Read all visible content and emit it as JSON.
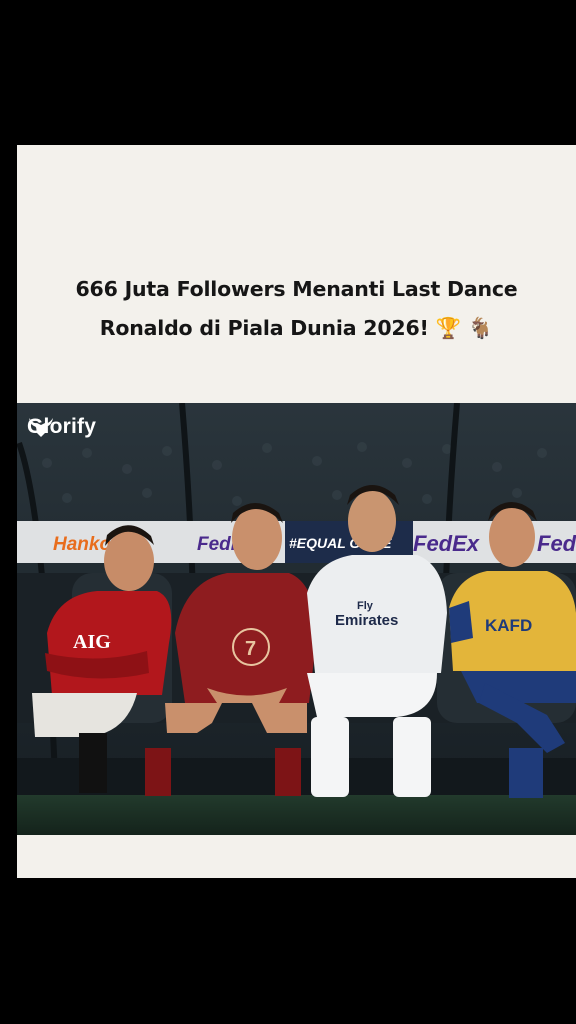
{
  "post": {
    "headline_line1": "666 Juta Followers Menanti Last Dance",
    "headline_line2": "Ronaldo di Piala Dunia 2026!",
    "emoji_trophy": "🏆",
    "emoji_goat": "🐐"
  },
  "photo": {
    "watermark_brand": "Glorify",
    "board_ads": [
      "Hankook",
      "FedEx",
      "#EQUAL GAME",
      "FedEx",
      "FedEx"
    ],
    "jerseys": [
      {
        "sponsor": "AIG"
      },
      {
        "number": "7"
      },
      {
        "sponsor_top": "Fly",
        "sponsor_bottom": "Emirates"
      },
      {
        "sponsor": "KAFD"
      }
    ]
  },
  "colors": {
    "background": "#000000",
    "card": "#f3f1ec",
    "united_red": "#b2171c",
    "portugal_red": "#8e1c1f",
    "real_white": "#eceef0",
    "nassr_yellow": "#e3b53a",
    "nassr_blue": "#1f3b7a"
  }
}
